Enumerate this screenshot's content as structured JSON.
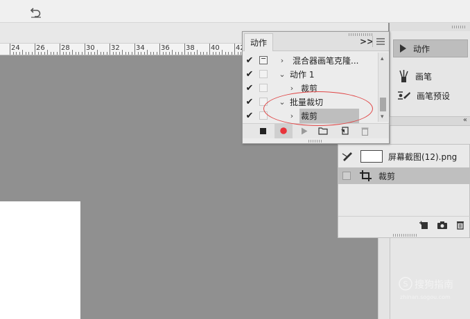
{
  "ruler": {
    "labels": [
      "24",
      "26",
      "28",
      "30",
      "32",
      "34",
      "36",
      "38",
      "40",
      "42"
    ]
  },
  "actions_panel": {
    "tab_label": "动作",
    "expand_glyph": ">>",
    "rows": [
      {
        "label": "混合器画笔克隆...",
        "checked": true,
        "dialog": true,
        "twisty": "›"
      },
      {
        "label": "动作 1",
        "checked": true,
        "dialog": false,
        "twisty": "⌄"
      },
      {
        "label": "裁剪",
        "checked": true,
        "dialog": false,
        "twisty": "›"
      },
      {
        "label": "批量裁切",
        "checked": true,
        "dialog": false,
        "twisty": "⌄"
      },
      {
        "label": "裁剪",
        "checked": true,
        "dialog": false,
        "twisty": "›"
      }
    ]
  },
  "dock": {
    "actions_label": "动作",
    "brush_label": "画笔",
    "brush_preset_label": "画笔预设"
  },
  "history_panel": {
    "snapshot_label": "屏幕截图(12).png",
    "step_label": "裁剪"
  },
  "watermark": {
    "text": "搜狗指南",
    "subtext": "zhinan.sogou.com"
  },
  "colors": {
    "canvas": "#909090",
    "record_red": "#e8333a",
    "annotation_red": "#e04545"
  }
}
